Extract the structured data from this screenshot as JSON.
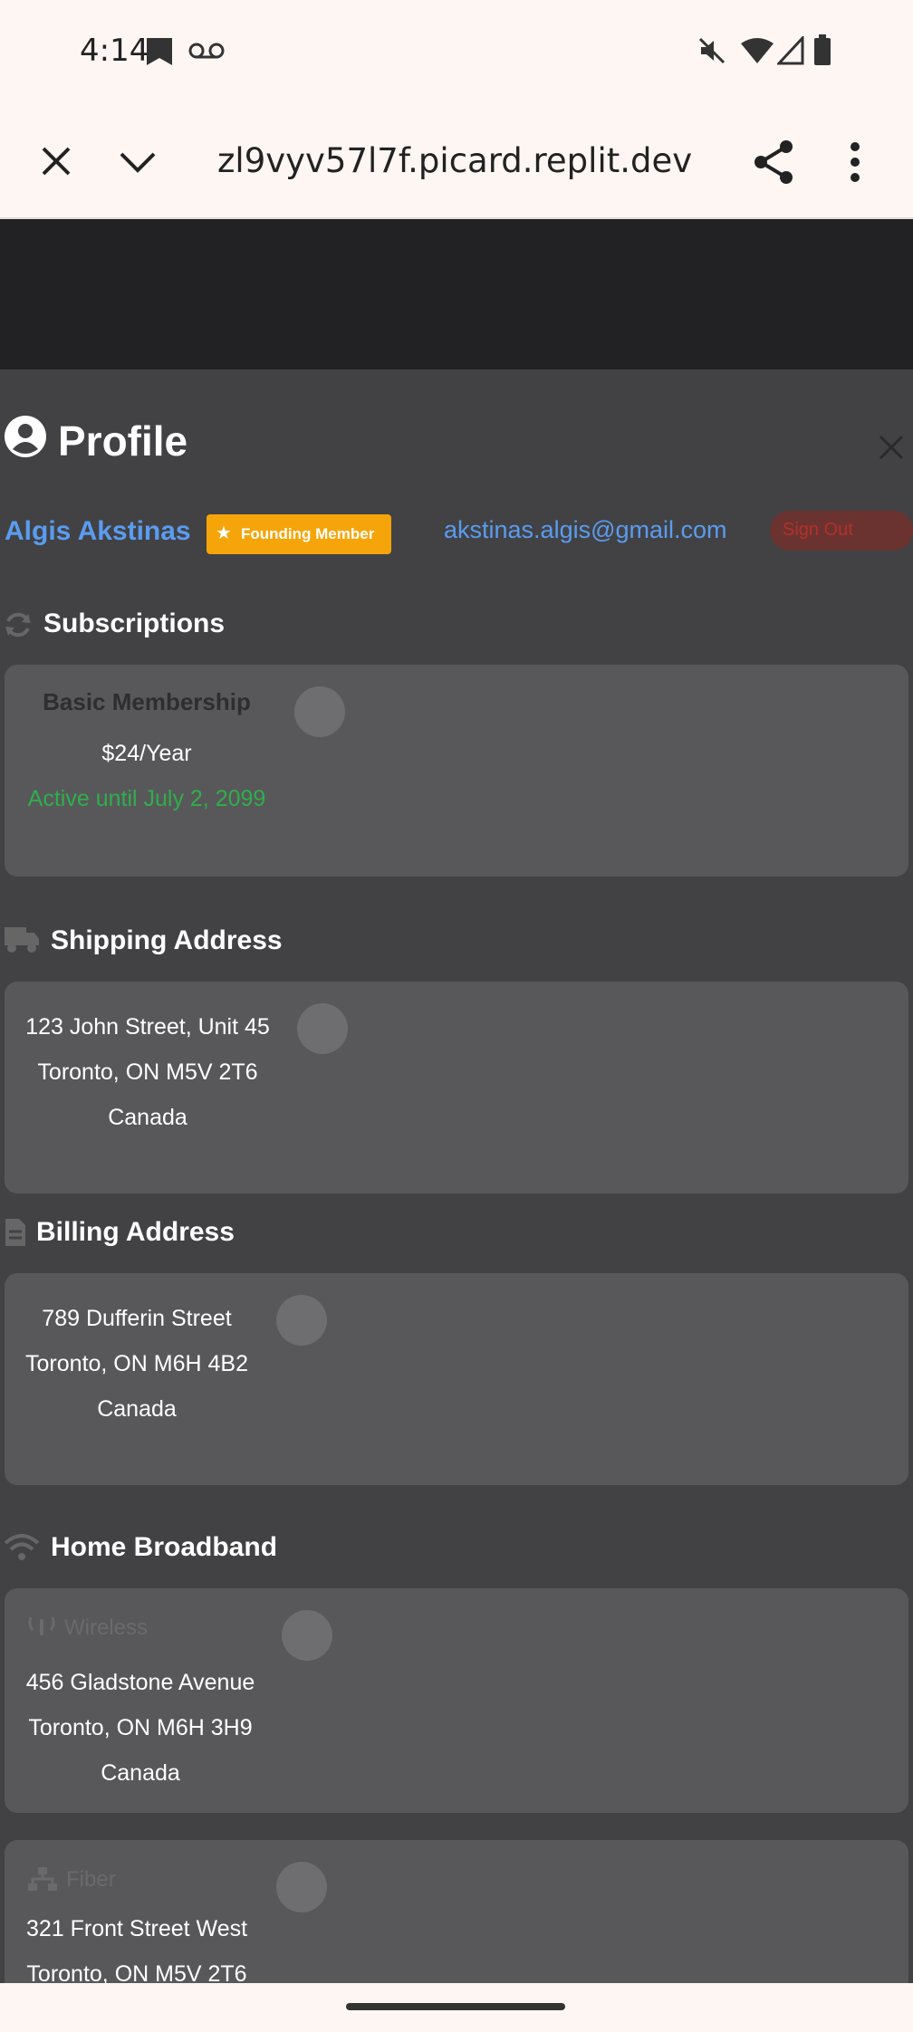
{
  "status_bar": {
    "time": "4:14",
    "icons": [
      "notification-icon",
      "voicemail-icon",
      "mute-icon",
      "wifi-icon",
      "signal-icon",
      "battery-icon"
    ]
  },
  "browser": {
    "url": "zl9vyv57l7f.picard.replit.dev",
    "icons": [
      "close-icon",
      "chevron-down-icon",
      "share-icon",
      "more-icon"
    ]
  },
  "profile": {
    "title": "Profile",
    "name": "Algis Akstinas",
    "badge": "Founding Member",
    "email": "akstinas.algis@gmail.com",
    "status_pill": "Sign Out"
  },
  "subscriptions": {
    "heading": "Subscriptions",
    "plan": "Basic Membership",
    "price": "$24/Year",
    "status": "Active until July 2, 2099"
  },
  "shipping": {
    "heading": "Shipping Address",
    "line1": "123 John Street, Unit 45",
    "line2": "Toronto, ON M5V 2T6",
    "line3": "Canada"
  },
  "billing": {
    "heading": "Billing Address",
    "line1": "789 Dufferin Street",
    "line2": "Toronto, ON M6H 4B2",
    "line3": "Canada"
  },
  "broadband": {
    "heading": "Home Broadband",
    "wireless": {
      "type": "Wireless",
      "line1": "456 Gladstone Avenue",
      "line2": "Toronto, ON M6H 3H9",
      "line3": "Canada"
    },
    "fiber": {
      "type": "Fiber",
      "line1": "321 Front Street West",
      "line2": "Toronto, ON M5V 2T6"
    }
  },
  "colors": {
    "link": "#5a9cf0",
    "active": "#2fae4d",
    "badge": "#f5a50a",
    "danger": "#b5302a"
  }
}
